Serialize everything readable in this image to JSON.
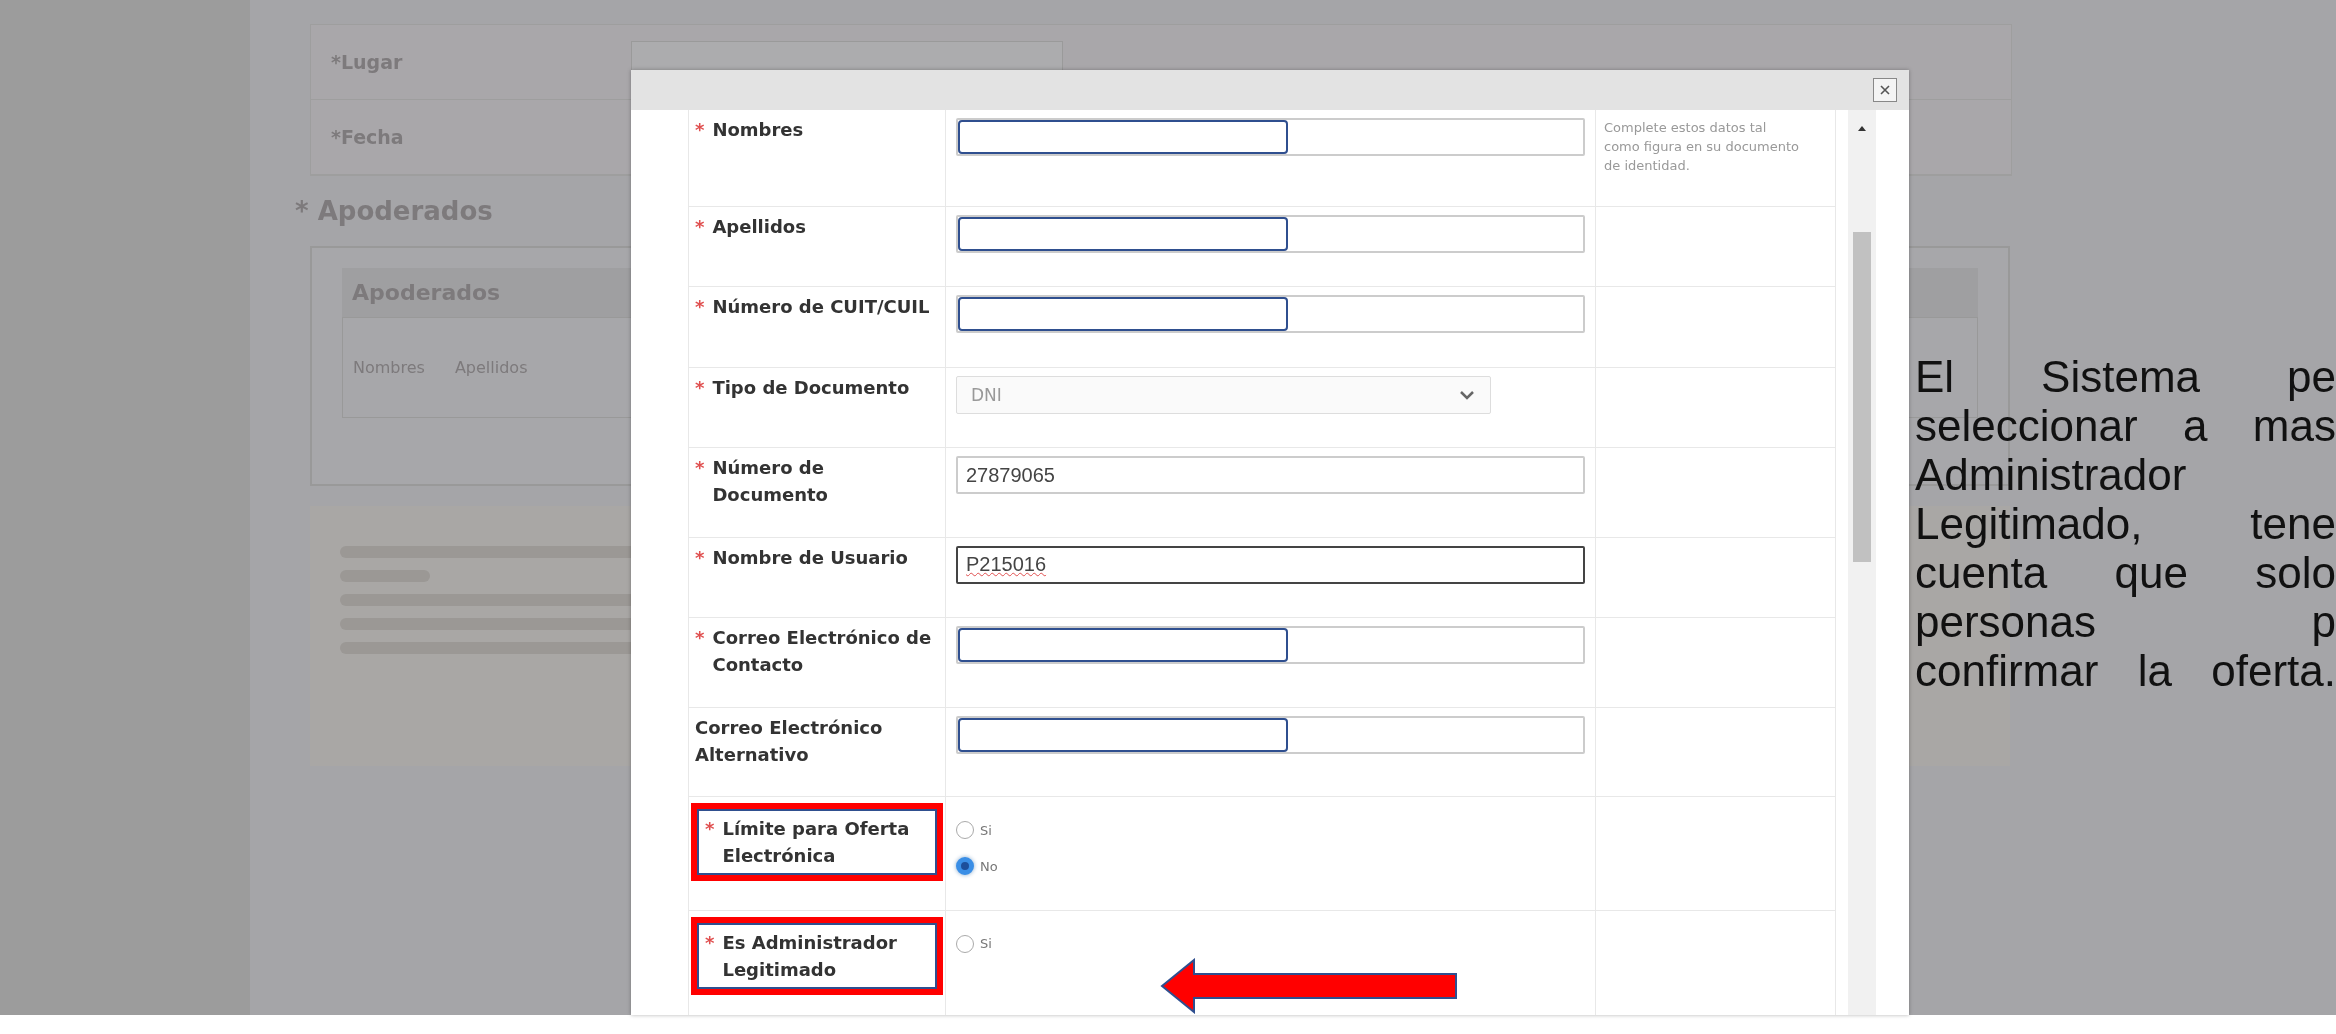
{
  "background_form": {
    "rows": [
      {
        "label": "*Lugar"
      },
      {
        "label": "*Fecha"
      }
    ],
    "section_title": "* Apoderados",
    "panel_title": "Apoderados",
    "columns": [
      "Nombres",
      "Apellidos"
    ]
  },
  "dialog": {
    "help_text": "Complete estos datos tal como figura en su documento de identidad.",
    "fields": [
      {
        "kind": "text",
        "required_mark": "*",
        "label": "Nombres",
        "redacted": true,
        "focused": false,
        "highlighted": false
      },
      {
        "kind": "text",
        "required_mark": "*",
        "label": "Apellidos",
        "redacted": true,
        "focused": false,
        "highlighted": false
      },
      {
        "kind": "text",
        "required_mark": "*",
        "label": "Número de CUIT/CUIL",
        "redacted": true,
        "focused": false,
        "highlighted": false
      },
      {
        "kind": "select",
        "required_mark": "*",
        "label": "Tipo de Documento",
        "value": "DNI",
        "highlighted": false
      },
      {
        "kind": "text",
        "required_mark": "*",
        "label": "Número de Documento",
        "value": "27879065",
        "focused": false,
        "highlighted": false
      },
      {
        "kind": "text",
        "required_mark": "*",
        "label": "Nombre de Usuario",
        "value": "P215016",
        "focused": true,
        "highlighted": false
      },
      {
        "kind": "text",
        "required_mark": "*",
        "label": "Correo Electrónico de Contacto",
        "redacted": true,
        "focused": false,
        "highlighted": false
      },
      {
        "kind": "text",
        "label": "Correo Electrónico Alternativo",
        "redacted": true,
        "focused": false,
        "highlighted": false
      },
      {
        "kind": "radio",
        "required_mark": "*",
        "label": "Límite para Oferta Electrónica",
        "highlighted": true,
        "options": [
          {
            "label": "Si",
            "selected": false
          },
          {
            "label": "No",
            "selected": true
          }
        ]
      },
      {
        "kind": "radio",
        "required_mark": "*",
        "label": "Es Administrador Legitimado",
        "highlighted": true,
        "options": [
          {
            "label": "Si",
            "selected": false
          }
        ]
      }
    ]
  },
  "callout": {
    "lines": [
      "El Sistema pe",
      "seleccionar a mas",
      "Administrador",
      "Legitimado, tene",
      "cuenta que solo",
      "personas p",
      "confirmar la oferta."
    ]
  }
}
